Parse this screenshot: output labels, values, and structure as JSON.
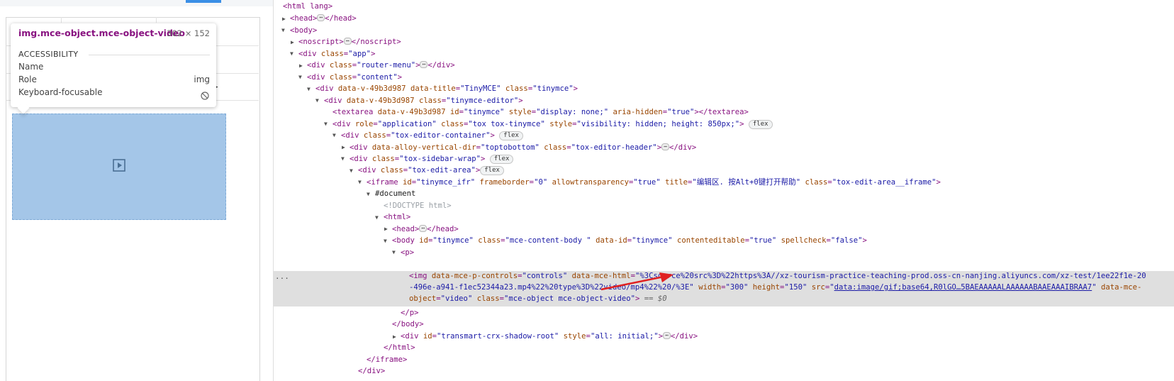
{
  "tooltip": {
    "selector": "img.mce-object.mce-object-video",
    "dimensions": "302 × 152",
    "section": "ACCESSIBILITY",
    "name_label": "Name",
    "role_label": "Role",
    "role_value": "img",
    "keyboard_label": "Keyboard-focusable"
  },
  "icons": {
    "video": "video-play-icon",
    "not_focusable": "block-icon",
    "arrow": "red-arrow-annotation"
  },
  "colors": {
    "tag": "#881280",
    "attribute": "#994500",
    "value": "#1a1aa6",
    "selected_row": "#dfdfdf",
    "annotation": "#e02020"
  },
  "dom": {
    "l1": {
      "tag": "<html lang>"
    },
    "l2": {
      "open": "<head>",
      "close": "</head>"
    },
    "l3": {
      "tag": "<body>"
    },
    "l4": {
      "open": "<noscript>",
      "close": "</noscript>"
    },
    "l5": {
      "open": "<div ",
      "a1": "class",
      "v1": "\"app\"",
      "end": ">"
    },
    "l6": {
      "open": "<div ",
      "a1": "class",
      "v1": "\"router-menu\"",
      "end": ">",
      "close": "</div>"
    },
    "l7": {
      "open": "<div ",
      "a1": "class",
      "v1": "\"content\"",
      "end": ">"
    },
    "l8": {
      "open": "<div ",
      "a1": "data-v-49b3d987",
      "a2": "data-title",
      "v2": "\"TinyMCE\"",
      "a3": "class",
      "v3": "\"tinymce\"",
      "end": ">"
    },
    "l9": {
      "open": "<div ",
      "a1": "data-v-49b3d987",
      "a2": "class",
      "v2": "\"tinymce-editor\"",
      "end": ">"
    },
    "l10": {
      "open": "<textarea ",
      "a1": "data-v-49b3d987",
      "a2": "id",
      "v2": "\"tinymce\"",
      "a3": "style",
      "v3": "\"display: none;\"",
      "a4": "aria-hidden",
      "v4": "\"true\"",
      "end": ">",
      "close": "</textarea>"
    },
    "l11": {
      "open": "<div ",
      "a1": "role",
      "v1": "\"application\"",
      "a2": "class",
      "v2": "\"tox tox-tinymce\"",
      "a3": "style",
      "v3": "\"visibility: hidden; height: 850px;\"",
      "end": ">",
      "pill": "flex"
    },
    "l12": {
      "open": "<div ",
      "a1": "class",
      "v1": "\"tox-editor-container\"",
      "end": ">",
      "pill": "flex"
    },
    "l13": {
      "open": "<div ",
      "a1": "data-alloy-vertical-dir",
      "v1": "\"toptobottom\"",
      "a2": "class",
      "v2": "\"tox-editor-header\"",
      "end": ">",
      "close": "</div>"
    },
    "l14": {
      "open": "<div ",
      "a1": "class",
      "v1": "\"tox-sidebar-wrap\"",
      "end": ">",
      "pill": "flex"
    },
    "l15": {
      "open": "<div ",
      "a1": "class",
      "v1": "\"tox-edit-area\"",
      "end": ">",
      "pill": "flex"
    },
    "l16": {
      "open": "<iframe ",
      "a1": "id",
      "v1": "\"tinymce_ifr\"",
      "a2": "frameborder",
      "v2": "\"0\"",
      "a3": "allowtransparency",
      "v3": "\"true\"",
      "a4": "title",
      "v4": "\"编辑区. 按Alt+0键打开帮助\"",
      "a5": "class",
      "v5": "\"tox-edit-area__iframe\"",
      "end": ">"
    },
    "l17": {
      "text": "#document"
    },
    "l18": {
      "comment": "<!DOCTYPE html>"
    },
    "l19": {
      "tag": "<html>"
    },
    "l20": {
      "open": "<head>",
      "close": "</head>"
    },
    "l21": {
      "open": "<body ",
      "a1": "id",
      "v1": "\"tinymce\"",
      "a2": "class",
      "v2": "\"mce-content-body \"",
      "a3": "data-id",
      "v3": "\"tinymce\"",
      "a4": "contenteditable",
      "v4": "\"true\"",
      "a5": "spellcheck",
      "v5": "\"false\"",
      "end": ">"
    },
    "l22": {
      "tag": "<p>"
    },
    "l23": {
      "open": "<img ",
      "a1": "data-mce-p-controls",
      "v1": "\"controls\"",
      "a2": "data-mce-html",
      "v2a": "\"%3Csource%20src%3D%22https%3A//xz-tourism-practice-teaching-prod.oss-cn-nanjing.aliyuncs.com/xz-test/1ee22f1e-20"
    },
    "l24": {
      "v2b": "-496e-a941-f1ec52344a23.mp4%22%20type%3D%22video/mp4%22%20/%3E\"",
      "a3": "width",
      "v3": "\"300\"",
      "a4": "height",
      "v4": "\"150\"",
      "a5": "src",
      "v5": "data:image/gif;base64,R0lGO…5BAEAAAAALAAAAAABAAEAAAIBRAA7",
      "a6": "data-mce-"
    },
    "l25": {
      "a6b": "object",
      "v6": "\"video\"",
      "a7": "class",
      "v7": "\"mce-object mce-object-video\"",
      "end": ">",
      "eq": " == $0"
    },
    "l26": {
      "tag": "</p>"
    },
    "l27": {
      "tag": "</body>"
    },
    "l28": {
      "open": "<div ",
      "a1": "id",
      "v1": "\"transmart-crx-shadow-root\"",
      "a2": "style",
      "v2": "\"all: initial;\"",
      "end": ">",
      "close": "</div>"
    },
    "l29": {
      "tag": "</html>"
    },
    "l30": {
      "tag": "</iframe>"
    },
    "l31": {
      "tag": "</div>"
    },
    "dots": "⋯",
    "gutter_ellipsis": "···"
  }
}
